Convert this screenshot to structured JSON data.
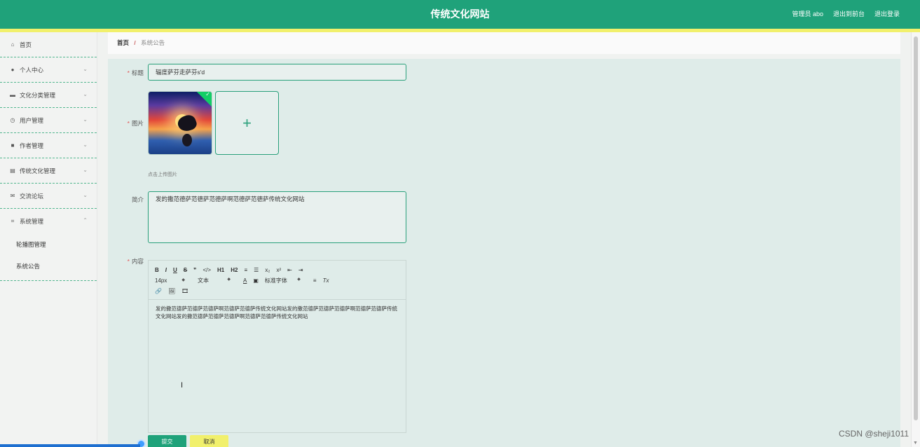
{
  "header": {
    "title": "传统文化网站",
    "user_label": "管理员 abo",
    "back_label": "退出到前台",
    "logout_label": "退出登录"
  },
  "sidebar": {
    "items": [
      {
        "label": "首页",
        "icon": "home-icon",
        "has_arrow": false
      },
      {
        "label": "个人中心",
        "icon": "user-icon",
        "has_arrow": true
      },
      {
        "label": "文化分类管理",
        "icon": "briefcase-icon",
        "has_arrow": true
      },
      {
        "label": "用户管理",
        "icon": "clock-icon",
        "has_arrow": true
      },
      {
        "label": "作者管理",
        "icon": "video-icon",
        "has_arrow": true
      },
      {
        "label": "传统文化管理",
        "icon": "printer-icon",
        "has_arrow": true
      },
      {
        "label": "交流论坛",
        "icon": "mail-icon",
        "has_arrow": true
      },
      {
        "label": "系统管理",
        "icon": "crop-icon",
        "has_arrow": true,
        "expanded": true
      }
    ],
    "subitems": [
      "轮播图管理",
      "系统公告"
    ]
  },
  "breadcrumb": {
    "home": "首页",
    "separator": "/",
    "current": "系统公告"
  },
  "form": {
    "title_label": "标题",
    "title_value": "辐度萨芬走萨芬s'd",
    "image_label": "图片",
    "upload_tip": "点击上传图片",
    "intro_label": "简介",
    "intro_value": "发的撒范德萨范德萨范德萨啊范德萨范德萨传统文化网站",
    "content_label": "内容",
    "content_value": "发的撒范德萨范德萨范德萨啊范德萨范德萨传统文化网站发的撒范德萨范德萨范德萨啊范德萨范德萨传统文化网站发的撒范德萨范德萨范德萨啊范德萨范德萨传统文化网站"
  },
  "editor_toolbar": {
    "row1": [
      "B",
      "I",
      "U",
      "S",
      "❞",
      "</>",
      "H1",
      "H2",
      "≡",
      "☰",
      "x₂",
      "x²",
      "⇤",
      "⇥"
    ],
    "font_size": "14px",
    "text_type": "文本",
    "font_family": "标准字体",
    "row2_tail": [
      "A",
      "▣",
      "≡",
      "Tx"
    ],
    "row3": [
      "🔗",
      "🖼",
      "🎞"
    ]
  },
  "buttons": {
    "submit": "提交",
    "cancel": "取消"
  },
  "watermark": "CSDN @sheji1011",
  "colors": {
    "primary": "#1fa27a",
    "accent_yellow": "#f1f06c",
    "required": "#e25555"
  }
}
